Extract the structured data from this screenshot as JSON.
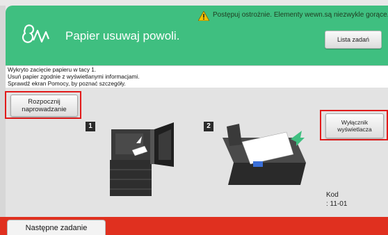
{
  "header": {
    "title": "Papier usuwaj powoli.",
    "warning": "Postępuj ostrożnie. Elementy wewn.są niezwykle gorące.",
    "jobs_button": "Lista zadań",
    "colors": {
      "header_bg": "#3fbf80",
      "warning_icon": "#f2c200"
    },
    "icons": {
      "logo": "paper-jam-logo-icon",
      "warning": "warning-triangle-icon"
    }
  },
  "info": {
    "line1": "Wykryto zacięcie papieru w tacy 1.",
    "line2": "Usuń papier zgodnie z wyświetlanymi informacjami.",
    "line3": "Sprawdź ekran Pomocy, by poznać szczegóły."
  },
  "main": {
    "guide_button": {
      "line1": "Rozpocznij",
      "line2": "naprowadzanie"
    },
    "display_switch_button": {
      "line1": "Wyłącznik",
      "line2": "wyświetlacza"
    },
    "step1": "1",
    "step2": "2",
    "code_label": "Kod",
    "code_value": ": 11-01",
    "highlight_color": "#e21a1a"
  },
  "footer": {
    "next_job": "Następne zadanie",
    "color": "#e0301f"
  }
}
